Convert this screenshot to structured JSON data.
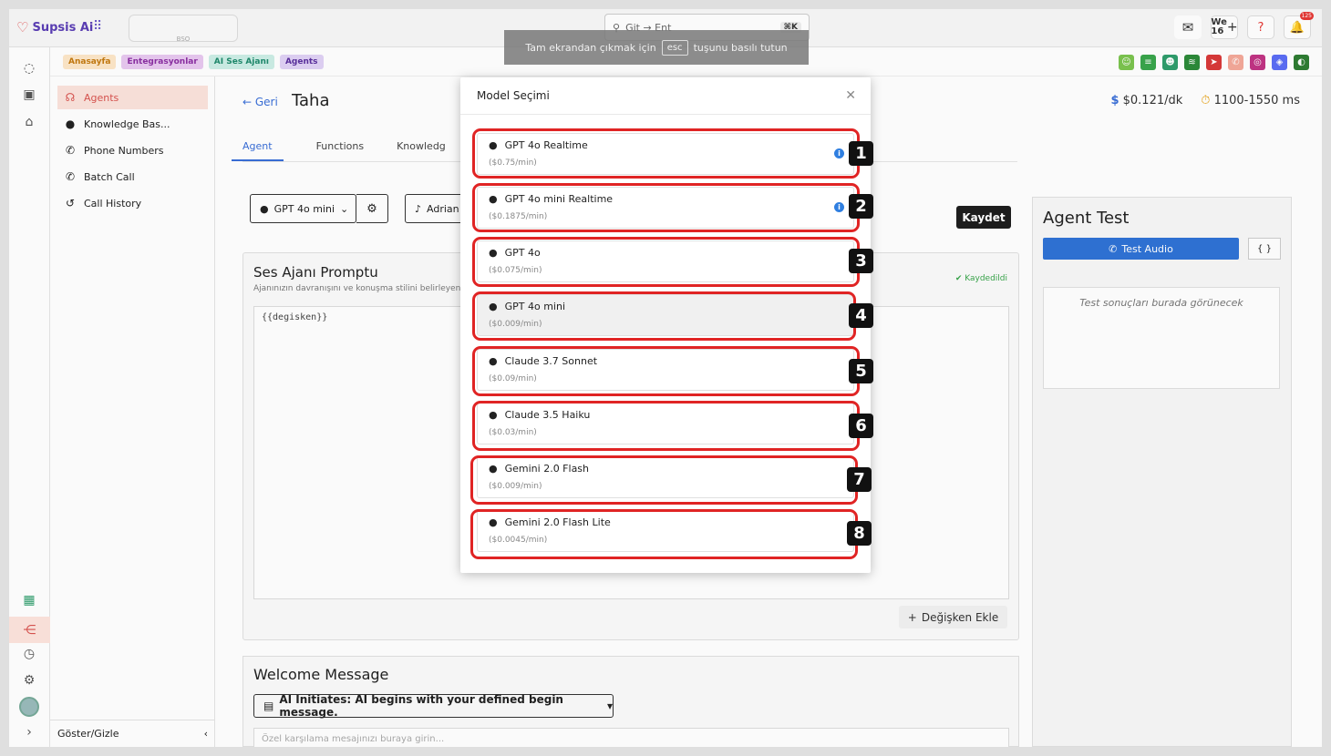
{
  "app": {
    "brand": "Supsis Ai",
    "org_placeholder": "BSO"
  },
  "search": {
    "placeholder": "Git → Ent",
    "shortcut": "⌘K"
  },
  "fullscreen_notice": {
    "before": "Tam ekrandan çıkmak için",
    "key": "esc",
    "after": "tuşunu basılı tutun"
  },
  "topright": {
    "we_label": "We",
    "we_count": "16",
    "notif_count": "125"
  },
  "breadcrumbs": [
    "Anasayfa",
    "Entegrasyonlar",
    "AI Ses Ajanı",
    "Agents"
  ],
  "sidebar": {
    "items": [
      {
        "label": "Agents"
      },
      {
        "label": "Knowledge Bas..."
      },
      {
        "label": "Phone Numbers"
      },
      {
        "label": "Batch Call"
      },
      {
        "label": "Call History"
      }
    ],
    "footer": "Göster/Gizle"
  },
  "agent": {
    "back": "Geri",
    "name": "Taha",
    "price": "$0.121/dk",
    "latency": "1100-1550 ms",
    "tabs": [
      "Agent",
      "Functions",
      "Knowledg"
    ],
    "model_label": "GPT 4o mini",
    "voice_label": "Adrian",
    "save": "Kaydet"
  },
  "prompt": {
    "title": "Ses Ajanı Promptu",
    "subtitle": "Ajanınızın davranışını ve konuşma stilini belirleyen",
    "saved": "Kaydedildi",
    "value": "{{degisken}}",
    "add_variable": "Değişken Ekle"
  },
  "welcome": {
    "title": "Welcome Message",
    "select": "AI Initiates: AI begins with your defined begin message.",
    "placeholder": "Özel karşılama mesajınızı buraya girin..."
  },
  "test": {
    "title": "Agent Test",
    "button": "Test Audio",
    "code": "{ }",
    "placeholder": "Test sonuçları burada görünecek"
  },
  "modal": {
    "title": "Model Seçimi",
    "models": [
      {
        "name": "GPT 4o Realtime",
        "price": "($0.75/min)",
        "badge": "1"
      },
      {
        "name": "GPT 4o mini Realtime",
        "price": "($0.1875/min)",
        "badge": "2"
      },
      {
        "name": "GPT 4o",
        "price": "($0.075/min)",
        "badge": "3"
      },
      {
        "name": "GPT 4o mini",
        "price": "($0.009/min)",
        "badge": "4"
      },
      {
        "name": "Claude 3.7 Sonnet",
        "price": "($0.09/min)",
        "badge": "5"
      },
      {
        "name": "Claude 3.5 Haiku",
        "price": "($0.03/min)",
        "badge": "6"
      },
      {
        "name": "Gemini 2.0 Flash",
        "price": "($0.009/min)",
        "badge": "7"
      },
      {
        "name": "Gemini 2.0 Flash Lite",
        "price": "($0.0045/min)",
        "badge": "8"
      }
    ]
  },
  "colors": {
    "accent": "#2f73d6",
    "highlight": "#e02424",
    "active_bg": "#fbe3dc"
  }
}
